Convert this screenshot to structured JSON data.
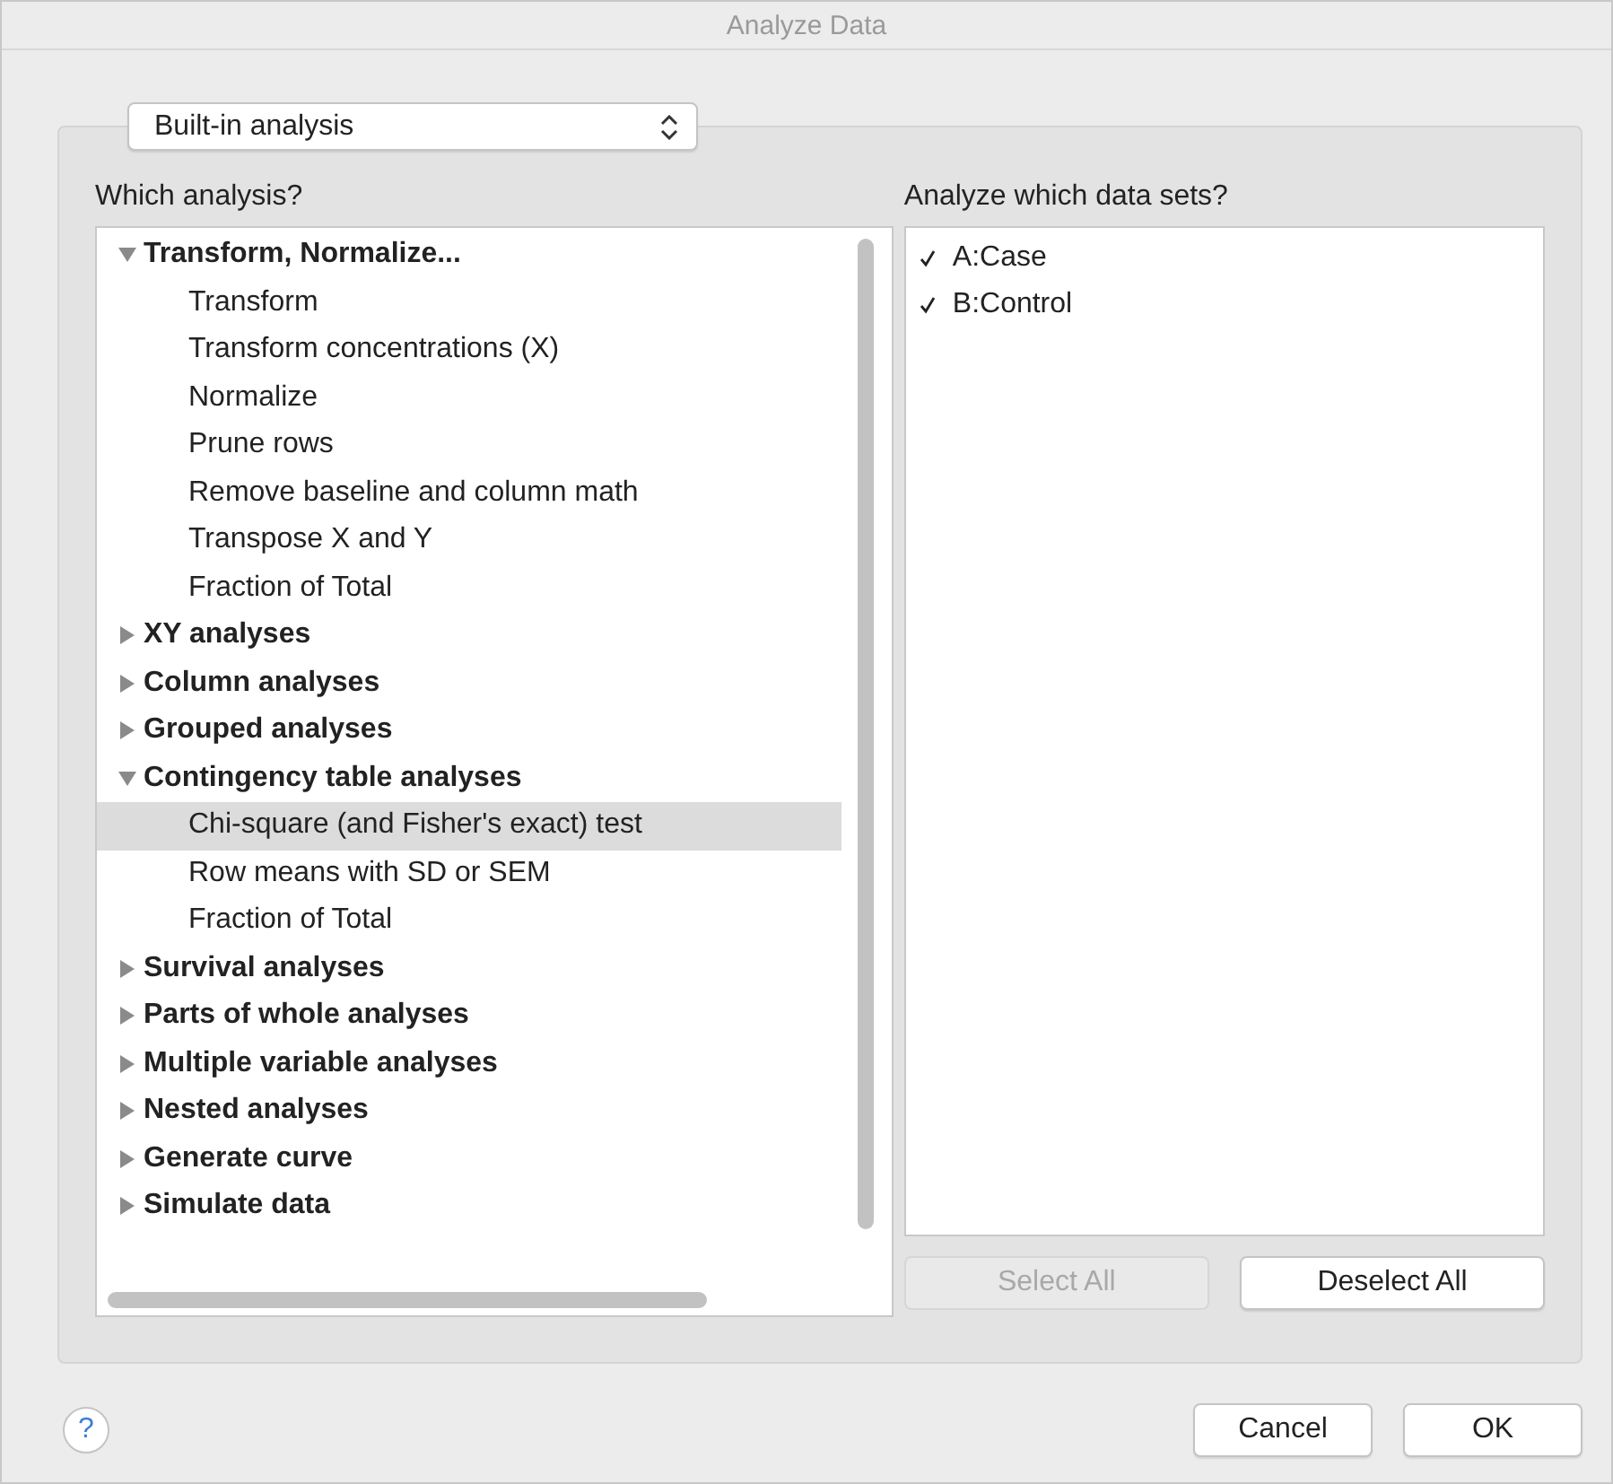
{
  "window": {
    "title": "Analyze Data"
  },
  "analysis_source": {
    "value": "Built-in analysis"
  },
  "analysis_list": {
    "label": "Which analysis?",
    "groups": [
      {
        "label": "Transform, Normalize...",
        "expanded": true,
        "children": [
          {
            "label": "Transform",
            "selected": false
          },
          {
            "label": "Transform concentrations (X)",
            "selected": false
          },
          {
            "label": "Normalize",
            "selected": false
          },
          {
            "label": "Prune rows",
            "selected": false
          },
          {
            "label": "Remove baseline and column math",
            "selected": false
          },
          {
            "label": "Transpose X and Y",
            "selected": false
          },
          {
            "label": "Fraction of Total",
            "selected": false
          }
        ]
      },
      {
        "label": "XY analyses",
        "expanded": false
      },
      {
        "label": "Column analyses",
        "expanded": false
      },
      {
        "label": "Grouped analyses",
        "expanded": false
      },
      {
        "label": "Contingency table analyses",
        "expanded": true,
        "children": [
          {
            "label": "Chi-square (and Fisher's exact) test",
            "selected": true
          },
          {
            "label": "Row means with SD or SEM",
            "selected": false
          },
          {
            "label": "Fraction of Total",
            "selected": false
          }
        ]
      },
      {
        "label": "Survival analyses",
        "expanded": false
      },
      {
        "label": "Parts of whole analyses",
        "expanded": false
      },
      {
        "label": "Multiple variable analyses",
        "expanded": false
      },
      {
        "label": "Nested analyses",
        "expanded": false
      },
      {
        "label": "Generate curve",
        "expanded": false
      },
      {
        "label": "Simulate data",
        "expanded": false
      }
    ]
  },
  "data_sets": {
    "label": "Analyze which data sets?",
    "items": [
      {
        "label": "A:Case",
        "checked": true
      },
      {
        "label": "B:Control",
        "checked": true
      }
    ]
  },
  "data_set_buttons": [
    {
      "label": "Select All",
      "disabled": true
    },
    {
      "label": "Deselect All",
      "disabled": false
    }
  ],
  "footer": {
    "help": "?",
    "buttons": [
      "Cancel",
      "OK"
    ]
  }
}
